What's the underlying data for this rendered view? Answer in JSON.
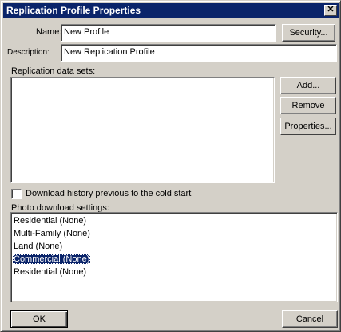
{
  "window": {
    "title": "Replication Profile Properties",
    "close_glyph": "✕"
  },
  "form": {
    "name_label": "Name:",
    "name_value": "New Profile",
    "description_label": "Description:",
    "description_value": "New Replication Profile",
    "security_button": "Security..."
  },
  "datasets": {
    "label": "Replication data sets:",
    "items": [],
    "add_button": "Add...",
    "remove_button": "Remove",
    "properties_button": "Properties..."
  },
  "history": {
    "label": "Download history previous to the cold start",
    "checked": false
  },
  "photo": {
    "label": "Photo download settings:",
    "items": [
      {
        "label": "Residential (None)",
        "selected": false
      },
      {
        "label": "Multi-Family (None)",
        "selected": false
      },
      {
        "label": "Land (None)",
        "selected": false
      },
      {
        "label": "Commercial (None)",
        "selected": true
      },
      {
        "label": "Residential (None)",
        "selected": false
      }
    ]
  },
  "footer": {
    "ok_button": "OK",
    "cancel_button": "Cancel"
  },
  "colors": {
    "titlebar": "#0a246a",
    "dialog_face": "#d4d0c8",
    "selection": "#0a246a"
  }
}
